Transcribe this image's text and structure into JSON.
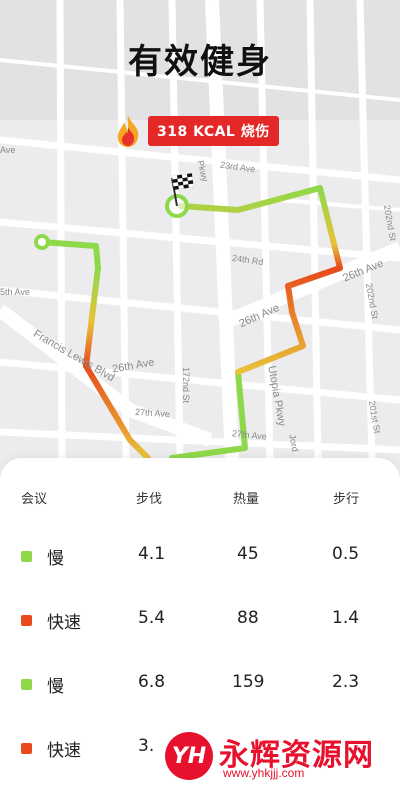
{
  "title": "有效健身",
  "calorie_badge": "318 KCAL 烧伤",
  "streets": [
    "23rd Ave",
    "24th Rd",
    "26th Ave",
    "26th Ave",
    "26th Ave",
    "Francis Lewis Blvd",
    "27th Ave",
    "27th Ave",
    "172nd St",
    "202nd St",
    "201st St",
    "Utopia Pkwy",
    "5th Ave",
    "Pkwy",
    "Ave",
    "Jord",
    "202nd St"
  ],
  "colors": {
    "slow": "#8ed94a",
    "fast": "#e84a1c",
    "route_start": "#8ed94a",
    "route_end": "#e32a1a",
    "badge": "#e42828"
  },
  "table": {
    "headers": [
      "会议",
      "步伐",
      "热量",
      "步行"
    ],
    "rows": [
      {
        "name": "慢",
        "pace": "4.1",
        "calories": "45",
        "walk": "0.5",
        "color": "#8ed94a"
      },
      {
        "name": "快速",
        "pace": "5.4",
        "calories": "88",
        "walk": "1.4",
        "color": "#e84a1c"
      },
      {
        "name": "慢",
        "pace": "6.8",
        "calories": "159",
        "walk": "2.3",
        "color": "#8ed94a"
      },
      {
        "name": "快速",
        "pace": "3.",
        "calories": "",
        "walk": "",
        "color": "#e84a1c"
      }
    ]
  },
  "watermark": {
    "logo": "YH",
    "text": "永辉资源网",
    "url": "www.yhkjjj.com"
  }
}
